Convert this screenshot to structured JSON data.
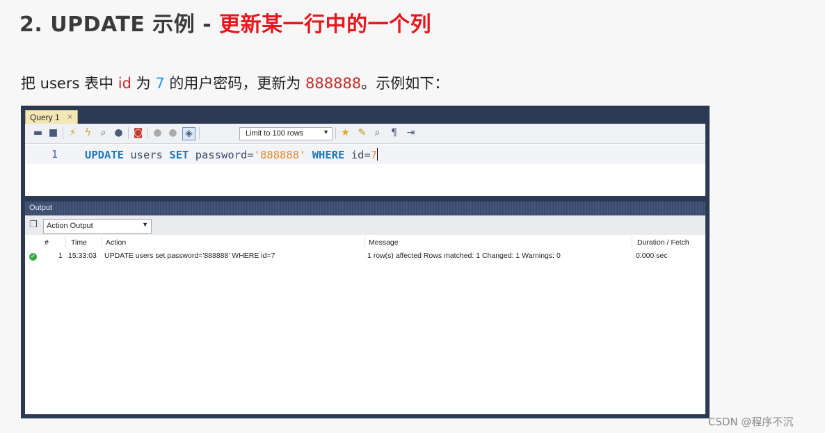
{
  "heading": {
    "prefix": "2. UPDATE 示例 - ",
    "highlight": "更新某一行中的一个列"
  },
  "intro": {
    "part1": "把 users 表中 ",
    "id_word": "id",
    "part2": " 为 ",
    "id_value": "7",
    "part3": " 的用户密码，更新为 ",
    "new_value": "888888",
    "part4": "。示例如下："
  },
  "query_tab": {
    "label": "Query 1",
    "close": "×"
  },
  "toolbar": {
    "limit_label": "Limit to 100 rows"
  },
  "editor": {
    "line_number": "1",
    "tokens": {
      "update": "UPDATE",
      "table": "users",
      "set": "SET",
      "column": "password=",
      "value": "'888888'",
      "where": "WHERE",
      "cond": "id=",
      "cond_value": "7"
    }
  },
  "output": {
    "title": "Output",
    "selector": "Action Output",
    "columns": {
      "num": "#",
      "time": "Time",
      "action": "Action",
      "message": "Message",
      "duration": "Duration / Fetch"
    },
    "rows": [
      {
        "num": "1",
        "time": "15:33:03",
        "action": "UPDATE users set password='888888' WHERE id=7",
        "message": "1 row(s) affected Rows matched: 1  Changed: 1  Warnings: 0",
        "duration": "0.000 sec"
      }
    ]
  },
  "watermark": "CSDN @程序不沉",
  "colors": {
    "heading_red": "#e8161c",
    "keyword_blue": "#1f77c2",
    "string_orange": "#e68a2e",
    "window_frame": "#2b3a52"
  }
}
